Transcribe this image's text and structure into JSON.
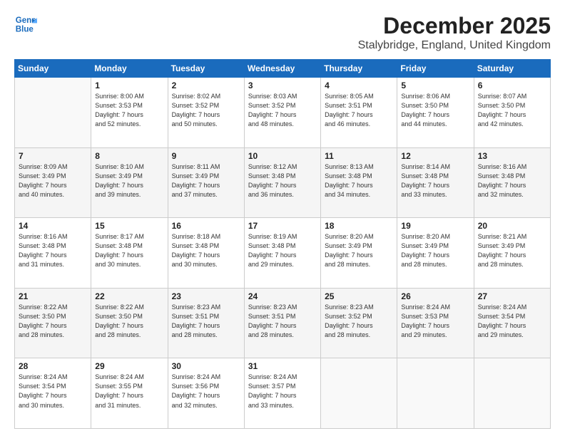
{
  "header": {
    "logo_line1": "General",
    "logo_line2": "Blue",
    "title": "December 2025",
    "subtitle": "Stalybridge, England, United Kingdom"
  },
  "calendar": {
    "weekdays": [
      "Sunday",
      "Monday",
      "Tuesday",
      "Wednesday",
      "Thursday",
      "Friday",
      "Saturday"
    ],
    "rows": [
      [
        {
          "day": "",
          "info": ""
        },
        {
          "day": "1",
          "info": "Sunrise: 8:00 AM\nSunset: 3:53 PM\nDaylight: 7 hours\nand 52 minutes."
        },
        {
          "day": "2",
          "info": "Sunrise: 8:02 AM\nSunset: 3:52 PM\nDaylight: 7 hours\nand 50 minutes."
        },
        {
          "day": "3",
          "info": "Sunrise: 8:03 AM\nSunset: 3:52 PM\nDaylight: 7 hours\nand 48 minutes."
        },
        {
          "day": "4",
          "info": "Sunrise: 8:05 AM\nSunset: 3:51 PM\nDaylight: 7 hours\nand 46 minutes."
        },
        {
          "day": "5",
          "info": "Sunrise: 8:06 AM\nSunset: 3:50 PM\nDaylight: 7 hours\nand 44 minutes."
        },
        {
          "day": "6",
          "info": "Sunrise: 8:07 AM\nSunset: 3:50 PM\nDaylight: 7 hours\nand 42 minutes."
        }
      ],
      [
        {
          "day": "7",
          "info": "Sunrise: 8:09 AM\nSunset: 3:49 PM\nDaylight: 7 hours\nand 40 minutes."
        },
        {
          "day": "8",
          "info": "Sunrise: 8:10 AM\nSunset: 3:49 PM\nDaylight: 7 hours\nand 39 minutes."
        },
        {
          "day": "9",
          "info": "Sunrise: 8:11 AM\nSunset: 3:49 PM\nDaylight: 7 hours\nand 37 minutes."
        },
        {
          "day": "10",
          "info": "Sunrise: 8:12 AM\nSunset: 3:48 PM\nDaylight: 7 hours\nand 36 minutes."
        },
        {
          "day": "11",
          "info": "Sunrise: 8:13 AM\nSunset: 3:48 PM\nDaylight: 7 hours\nand 34 minutes."
        },
        {
          "day": "12",
          "info": "Sunrise: 8:14 AM\nSunset: 3:48 PM\nDaylight: 7 hours\nand 33 minutes."
        },
        {
          "day": "13",
          "info": "Sunrise: 8:16 AM\nSunset: 3:48 PM\nDaylight: 7 hours\nand 32 minutes."
        }
      ],
      [
        {
          "day": "14",
          "info": "Sunrise: 8:16 AM\nSunset: 3:48 PM\nDaylight: 7 hours\nand 31 minutes."
        },
        {
          "day": "15",
          "info": "Sunrise: 8:17 AM\nSunset: 3:48 PM\nDaylight: 7 hours\nand 30 minutes."
        },
        {
          "day": "16",
          "info": "Sunrise: 8:18 AM\nSunset: 3:48 PM\nDaylight: 7 hours\nand 30 minutes."
        },
        {
          "day": "17",
          "info": "Sunrise: 8:19 AM\nSunset: 3:48 PM\nDaylight: 7 hours\nand 29 minutes."
        },
        {
          "day": "18",
          "info": "Sunrise: 8:20 AM\nSunset: 3:49 PM\nDaylight: 7 hours\nand 28 minutes."
        },
        {
          "day": "19",
          "info": "Sunrise: 8:20 AM\nSunset: 3:49 PM\nDaylight: 7 hours\nand 28 minutes."
        },
        {
          "day": "20",
          "info": "Sunrise: 8:21 AM\nSunset: 3:49 PM\nDaylight: 7 hours\nand 28 minutes."
        }
      ],
      [
        {
          "day": "21",
          "info": "Sunrise: 8:22 AM\nSunset: 3:50 PM\nDaylight: 7 hours\nand 28 minutes."
        },
        {
          "day": "22",
          "info": "Sunrise: 8:22 AM\nSunset: 3:50 PM\nDaylight: 7 hours\nand 28 minutes."
        },
        {
          "day": "23",
          "info": "Sunrise: 8:23 AM\nSunset: 3:51 PM\nDaylight: 7 hours\nand 28 minutes."
        },
        {
          "day": "24",
          "info": "Sunrise: 8:23 AM\nSunset: 3:51 PM\nDaylight: 7 hours\nand 28 minutes."
        },
        {
          "day": "25",
          "info": "Sunrise: 8:23 AM\nSunset: 3:52 PM\nDaylight: 7 hours\nand 28 minutes."
        },
        {
          "day": "26",
          "info": "Sunrise: 8:24 AM\nSunset: 3:53 PM\nDaylight: 7 hours\nand 29 minutes."
        },
        {
          "day": "27",
          "info": "Sunrise: 8:24 AM\nSunset: 3:54 PM\nDaylight: 7 hours\nand 29 minutes."
        }
      ],
      [
        {
          "day": "28",
          "info": "Sunrise: 8:24 AM\nSunset: 3:54 PM\nDaylight: 7 hours\nand 30 minutes."
        },
        {
          "day": "29",
          "info": "Sunrise: 8:24 AM\nSunset: 3:55 PM\nDaylight: 7 hours\nand 31 minutes."
        },
        {
          "day": "30",
          "info": "Sunrise: 8:24 AM\nSunset: 3:56 PM\nDaylight: 7 hours\nand 32 minutes."
        },
        {
          "day": "31",
          "info": "Sunrise: 8:24 AM\nSunset: 3:57 PM\nDaylight: 7 hours\nand 33 minutes."
        },
        {
          "day": "",
          "info": ""
        },
        {
          "day": "",
          "info": ""
        },
        {
          "day": "",
          "info": ""
        }
      ]
    ]
  }
}
